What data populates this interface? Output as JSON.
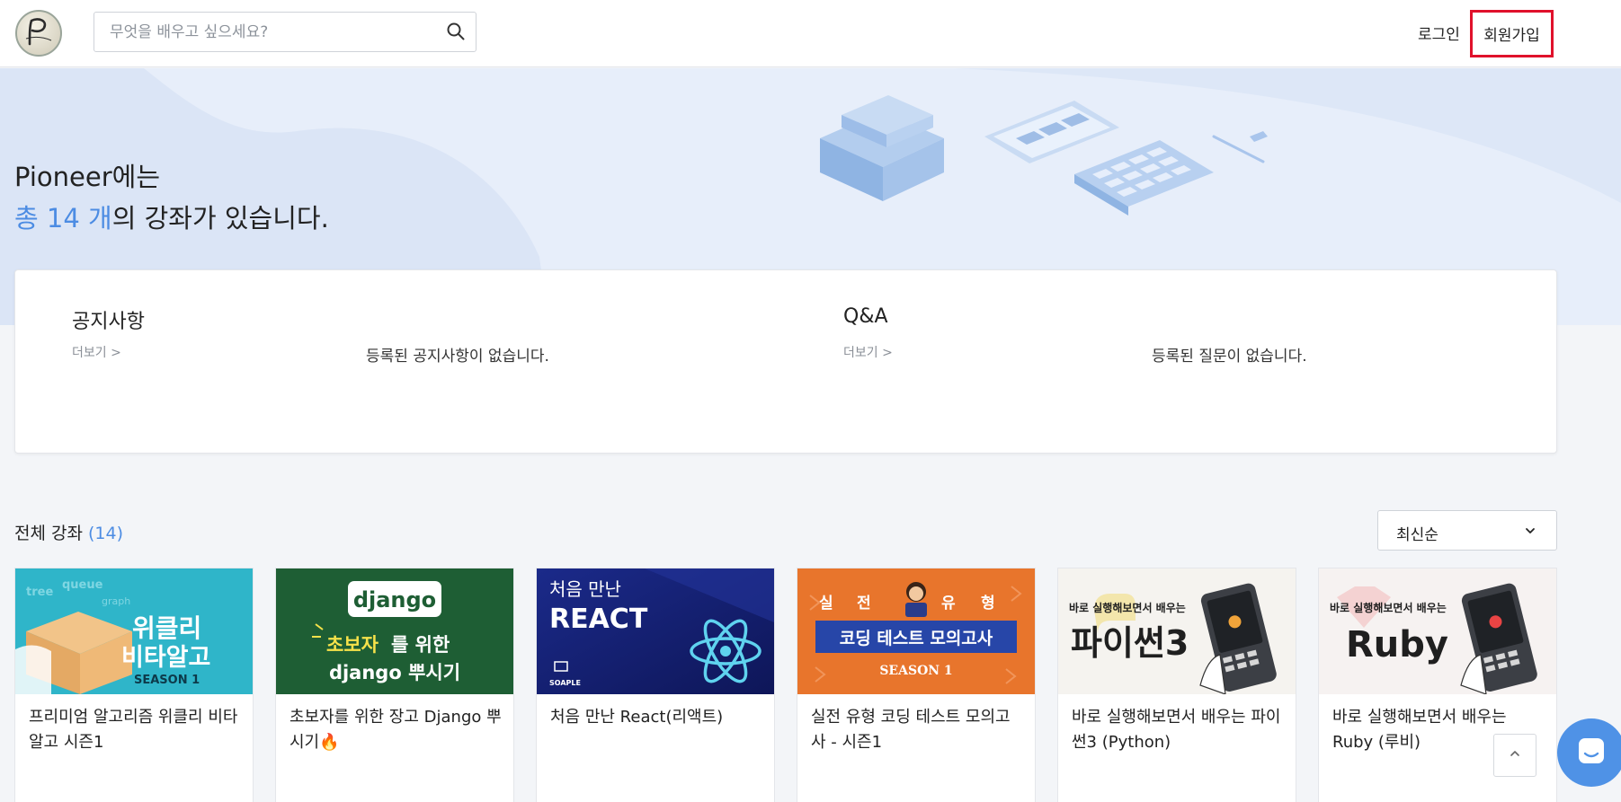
{
  "header": {
    "search_placeholder": "무엇을 배우고 싶으세요?",
    "login_label": "로그인",
    "signup_label": "회원가입"
  },
  "hero": {
    "line1": "Pioneer에는",
    "count_highlight": "총 14 개",
    "line2_rest": "의 강좌가 있습니다."
  },
  "notice": {
    "title": "공지사항",
    "more": "더보기 >",
    "empty": "등록된 공지사항이 없습니다."
  },
  "qa": {
    "title": "Q&A",
    "more": "더보기 >",
    "empty": "등록된 질문이 없습니다."
  },
  "courses": {
    "heading": "전체 강좌",
    "count": "(14)",
    "sort_label": "최신순",
    "items": [
      {
        "title": "프리미엄 알고리즘 위클리 비타알고 시즌1",
        "thumb_line1": "위클리",
        "thumb_line2": "비타알고",
        "thumb_sub": "SEASON 1",
        "thumb_deco1": "queue",
        "thumb_deco2": "tree",
        "thumb_deco3": "graph"
      },
      {
        "title": "초보자를 위한 장고 Django 뿌시기🔥",
        "thumb_logo": "django",
        "thumb_line1a": "초보자",
        "thumb_line1b": "를 위한",
        "thumb_line2": "django 뿌시기"
      },
      {
        "title": "처음 만난 React(리액트)",
        "thumb_line1": "처음 만난",
        "thumb_line2": "REACT",
        "thumb_brand": "SOAPLE"
      },
      {
        "title": "실전 유형 코딩 테스트 모의고사 - 시즌1",
        "thumb_chars": [
          "실",
          "전",
          "유",
          "형"
        ],
        "thumb_line1": "코딩 테스트 모의고사",
        "thumb_sub": "SEASON 1"
      },
      {
        "title": "바로 실행해보면서 배우는 파이썬3 (Python)",
        "thumb_top": "바로 실행해보면서 배우는",
        "thumb_main": "파이썬3"
      },
      {
        "title": "바로 실행해보면서 배우는 Ruby (루비)",
        "thumb_top": "바로 실행해보면서 배우는",
        "thumb_main": "Ruby"
      }
    ]
  },
  "colors": {
    "accent": "#4c8ce3",
    "signup_border": "#e0112b",
    "hero_bg": "#e7eefa"
  },
  "icons": {
    "search": "search-icon",
    "sort": "chevron-down-icon",
    "top": "chevron-up-icon",
    "chat": "chat-icon"
  }
}
